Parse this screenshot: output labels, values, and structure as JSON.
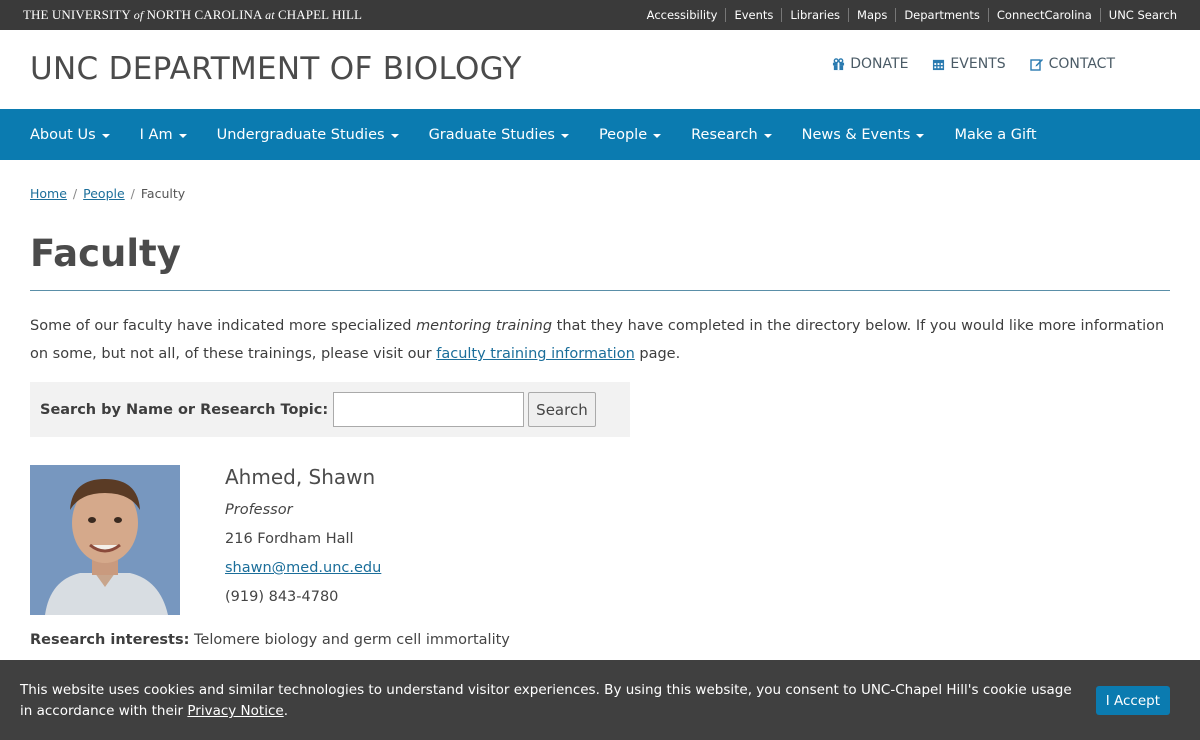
{
  "uni_bar": {
    "name_part1": "THE UNIVERSITY ",
    "name_of": "of",
    "name_part2": " NORTH CAROLINA ",
    "name_at": "at",
    "name_part3": " CHAPEL HILL",
    "links": [
      "Accessibility",
      "Events",
      "Libraries",
      "Maps",
      "Departments",
      "ConnectCarolina",
      "UNC Search"
    ]
  },
  "header": {
    "site_title": "UNC DEPARTMENT OF BIOLOGY",
    "util_links": {
      "donate": "DONATE",
      "events": "EVENTS",
      "contact": "CONTACT"
    }
  },
  "nav": {
    "items": [
      "About Us",
      "I Am",
      "Undergraduate Studies",
      "Graduate Studies",
      "People",
      "Research",
      "News & Events",
      "Make a Gift"
    ]
  },
  "breadcrumb": {
    "home": "Home",
    "people": "People",
    "current": "Faculty",
    "separator": "/"
  },
  "page": {
    "title": "Faculty",
    "intro_part1": "Some of our faculty have indicated more specialized ",
    "intro_em": "mentoring training",
    "intro_part2": " that they have completed in the directory below. If you would like more information on some, but not all, of these trainings, please visit our ",
    "intro_link": "faculty training information",
    "intro_part3": " page."
  },
  "search": {
    "label": "Search by Name or Research Topic:",
    "value": "",
    "button": "Search"
  },
  "faculty": {
    "name": "Ahmed, Shawn",
    "title": "Professor",
    "office": "216 Fordham Hall",
    "email": "shawn@med.unc.edu",
    "phone": "(919) 843-4780",
    "research_label": "Research interests:",
    "research_value": " Telomere biology and germ cell immortality"
  },
  "cookie": {
    "text": "This website uses cookies and similar technologies to understand visitor experiences. By using this website, you consent to UNC-Chapel Hill's cookie usage in accordance with their ",
    "link": "Privacy Notice",
    "end": ".",
    "accept": "I Accept"
  },
  "colors": {
    "nav_bg": "#0b7bb0",
    "uni_bar_bg": "#3a3a3a",
    "link": "#1b6e9a",
    "cookie_bg": "#404040"
  }
}
